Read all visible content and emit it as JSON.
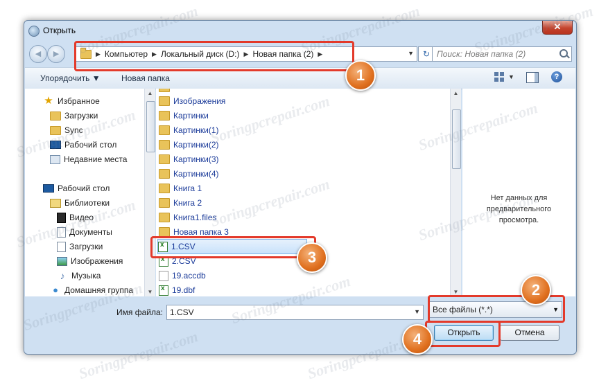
{
  "window": {
    "title": "Открыть",
    "close_label": "✕"
  },
  "address": {
    "crumbs": [
      "Компьютер",
      "Локальный диск (D:)",
      "Новая папка (2)"
    ],
    "refresh_glyph": "↻",
    "search_placeholder": "Поиск: Новая папка (2)"
  },
  "toolbar": {
    "organize": "Упорядочить ▼",
    "new_folder": "Новая папка",
    "help": "?"
  },
  "nav": {
    "favorites": "Избранное",
    "fav_items": [
      "Загрузки",
      "Sync",
      "Рабочий стол",
      "Недавние места"
    ],
    "desktop": "Рабочий стол",
    "libraries": "Библиотеки",
    "lib_items": [
      "Видео",
      "Документы",
      "Загрузки",
      "Изображения",
      "Музыка"
    ],
    "homegroup": "Домашняя группа"
  },
  "files": [
    {
      "name": "Изображения",
      "type": "folder"
    },
    {
      "name": "Картинки",
      "type": "folder"
    },
    {
      "name": "Картинки(1)",
      "type": "folder"
    },
    {
      "name": "Картинки(2)",
      "type": "folder"
    },
    {
      "name": "Картинки(3)",
      "type": "folder"
    },
    {
      "name": "Картинки(4)",
      "type": "folder"
    },
    {
      "name": "Книга 1",
      "type": "folder"
    },
    {
      "name": "Книга 2",
      "type": "folder"
    },
    {
      "name": "Книга1.files",
      "type": "folder"
    },
    {
      "name": "Новая папка 3",
      "type": "folder"
    },
    {
      "name": "1.CSV",
      "type": "csv",
      "selected": true
    },
    {
      "name": "2.CSV",
      "type": "csv"
    },
    {
      "name": "19.accdb",
      "type": "access"
    },
    {
      "name": "19.dbf",
      "type": "dbf"
    }
  ],
  "preview": {
    "empty_text": "Нет данных для предварительного просмотра."
  },
  "bottom": {
    "filename_label": "Имя файла:",
    "filename_value": "1.CSV",
    "filter_value": "Все файлы (*.*)",
    "open_label": "Открыть",
    "cancel_label": "Отмена"
  },
  "callouts": [
    "1",
    "2",
    "3",
    "4"
  ],
  "watermark": "Soringpcrepair.com",
  "colors": {
    "highlight": "#e33a2b",
    "badge": "#e0701f",
    "link_text": "#1a3a99"
  }
}
